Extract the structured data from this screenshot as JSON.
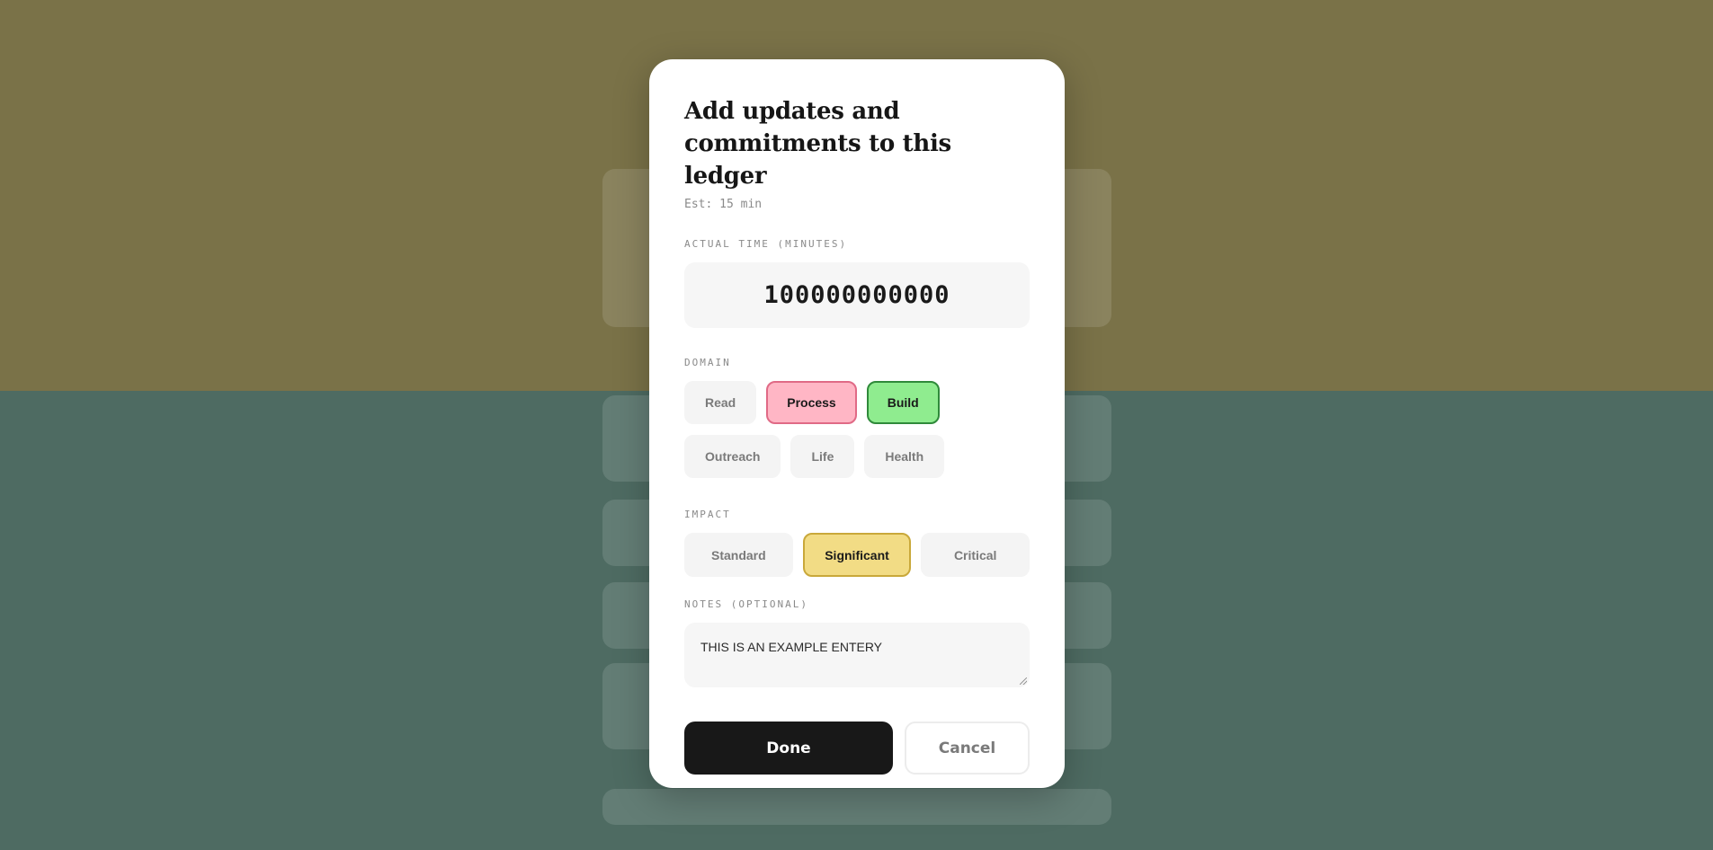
{
  "modal": {
    "title": "Add updates and commitments to this ledger",
    "estimate": "Est: 15 min"
  },
  "time": {
    "label": "ACTUAL TIME (MINUTES)",
    "value": "100000000000"
  },
  "domain": {
    "label": "DOMAIN",
    "options": [
      {
        "label": "Read",
        "selected": false
      },
      {
        "label": "Process",
        "selected": true,
        "color": "#ffb6c5"
      },
      {
        "label": "Build",
        "selected": true,
        "color": "#8fec8f"
      },
      {
        "label": "Outreach",
        "selected": false
      },
      {
        "label": "Life",
        "selected": false
      },
      {
        "label": "Health",
        "selected": false
      }
    ]
  },
  "impact": {
    "label": "IMPACT",
    "options": [
      {
        "label": "Standard",
        "selected": false
      },
      {
        "label": "Significant",
        "selected": true,
        "color": "#f2dc85"
      },
      {
        "label": "Critical",
        "selected": false
      }
    ]
  },
  "notes": {
    "label": "NOTES (OPTIONAL)",
    "value": "THIS IS AN EXAMPLE ENTERY"
  },
  "actions": {
    "done_label": "Done",
    "cancel_label": "Cancel"
  },
  "colors": {
    "backdrop_top": "#7a7248",
    "backdrop_bottom": "#4e6b62",
    "primary_button": "#181818"
  }
}
